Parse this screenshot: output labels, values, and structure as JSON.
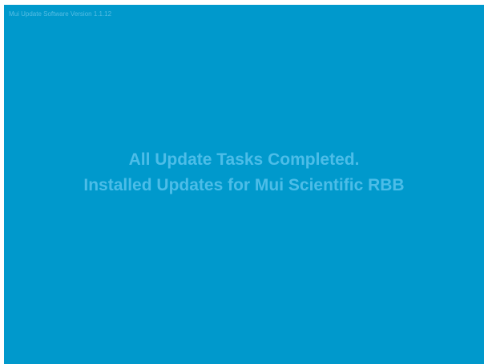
{
  "app": {
    "title": "Mui Update Software Version 1.1.12"
  },
  "status": {
    "line1": "All Update Tasks Completed.",
    "line2": "Installed Updates for Mui Scientific RBB"
  },
  "colors": {
    "background": "#0099cc",
    "text": "#4cbde8",
    "title_text": "#56bde3"
  }
}
